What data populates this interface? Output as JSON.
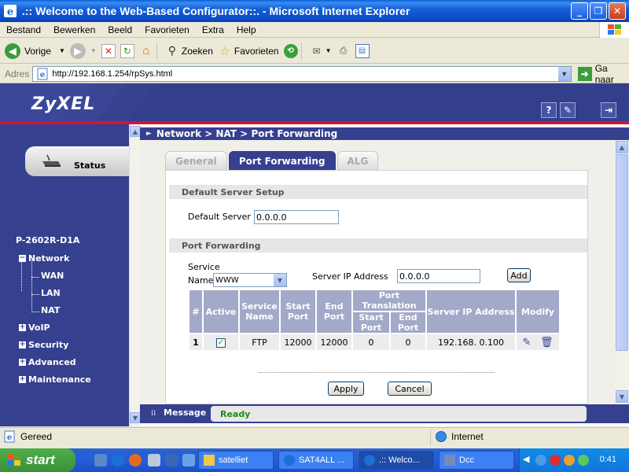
{
  "window": {
    "title": ".:: Welcome to the Web-Based Configurator::. - Microsoft Internet Explorer"
  },
  "menu": [
    "Bestand",
    "Bewerken",
    "Beeld",
    "Favorieten",
    "Extra",
    "Help"
  ],
  "toolbar": {
    "back_label": "Vorige",
    "search_label": "Zoeken",
    "favorites_label": "Favorieten"
  },
  "address": {
    "label": "Adres",
    "url": "http://192.168.1.254/rpSys.html",
    "go_label": "Ga naar"
  },
  "router": {
    "brand": "ZyXEL",
    "status_label": "Status",
    "model": "P-2602R-D1A",
    "nav": {
      "network": "Network",
      "wan": "WAN",
      "lan": "LAN",
      "nat": "NAT",
      "voip": "VoIP",
      "security": "Security",
      "advanced": "Advanced",
      "maintenance": "Maintenance"
    },
    "breadcrumb": "Network > NAT > Port Forwarding",
    "tabs": [
      "General",
      "Port Forwarding",
      "ALG"
    ],
    "active_tab": "Port Forwarding",
    "default_server": {
      "section_title": "Default Server Setup",
      "label": "Default Server",
      "value": "0.0.0.0"
    },
    "port_forwarding": {
      "section_title": "Port Forwarding",
      "service_label_line1": "Service",
      "service_label_line2": "Name",
      "service_value": "WWW",
      "server_ip_label": "Server IP Address",
      "server_ip_value": "0.0.0.0",
      "add_label": "Add"
    },
    "table": {
      "headers": {
        "num": "#",
        "active": "Active",
        "service_name": "Service Name",
        "start_port": "Start Port",
        "end_port": "End Port",
        "port_translation": "Port Translation",
        "pt_start": "Start Port",
        "pt_end": "End Port",
        "server_ip": "Server IP Address",
        "modify": "Modify"
      },
      "rows": [
        {
          "num": "1",
          "active": true,
          "service": "FTP",
          "start_port": "12000",
          "end_port": "12000",
          "pt_start": "0",
          "pt_end": "0",
          "server_ip": "192.168. 0.100"
        }
      ]
    },
    "apply_label": "Apply",
    "cancel_label": "Cancel",
    "message_label": "Message",
    "message_value": "Ready"
  },
  "statusbar": {
    "left": "Gereed",
    "zone": "Internet"
  },
  "taskbar": {
    "start_label": "start",
    "tasks": [
      "satelliet",
      "SAT4ALL ...",
      ".:: Welco...",
      "Dcc"
    ],
    "clock": "0:41"
  },
  "colors": {
    "zyxel_blue": "#35408f",
    "accent_red": "#d2143a",
    "ready_green": "#1d8a1d"
  }
}
